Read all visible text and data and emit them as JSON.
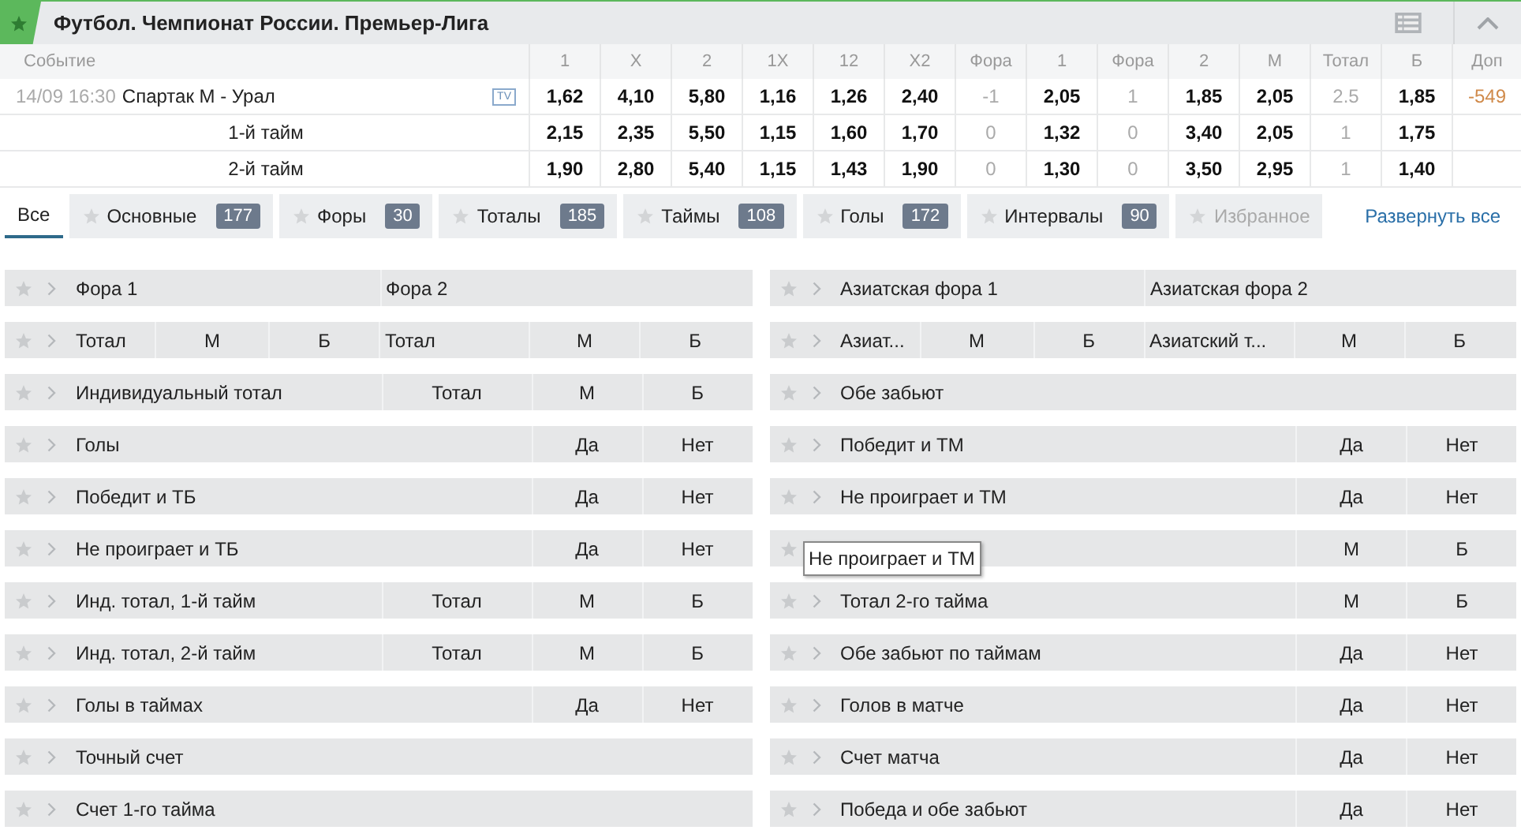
{
  "header": {
    "title": "Футбол. Чемпионат России. Премьер-Лига"
  },
  "table": {
    "event_heading": "Событие",
    "columns": [
      "1",
      "X",
      "2",
      "1X",
      "12",
      "X2",
      "Фора",
      "1",
      "Фора",
      "2",
      "М",
      "Тотал",
      "Б",
      "Доп"
    ],
    "rows": [
      {
        "kind": "match",
        "time": "14/09 16:30",
        "name": "Спартак М - Урал",
        "tv": "TV",
        "cells": [
          {
            "value": "1,62",
            "kind": "odd"
          },
          {
            "value": "4,10",
            "kind": "odd"
          },
          {
            "value": "5,80",
            "kind": "odd"
          },
          {
            "value": "1,16",
            "kind": "odd"
          },
          {
            "value": "1,26",
            "kind": "odd"
          },
          {
            "value": "2,40",
            "kind": "odd"
          },
          {
            "value": "-1",
            "kind": "param"
          },
          {
            "value": "2,05",
            "kind": "odd"
          },
          {
            "value": "1",
            "kind": "param"
          },
          {
            "value": "1,85",
            "kind": "odd"
          },
          {
            "value": "2,05",
            "kind": "odd"
          },
          {
            "value": "2.5",
            "kind": "param"
          },
          {
            "value": "1,85",
            "kind": "odd"
          },
          {
            "value": "-549",
            "kind": "extra"
          }
        ]
      },
      {
        "kind": "period",
        "name": "1-й тайм",
        "cells": [
          {
            "value": "2,15",
            "kind": "odd"
          },
          {
            "value": "2,35",
            "kind": "odd"
          },
          {
            "value": "5,50",
            "kind": "odd"
          },
          {
            "value": "1,15",
            "kind": "odd"
          },
          {
            "value": "1,60",
            "kind": "odd"
          },
          {
            "value": "1,70",
            "kind": "odd"
          },
          {
            "value": "0",
            "kind": "param"
          },
          {
            "value": "1,32",
            "kind": "odd"
          },
          {
            "value": "0",
            "kind": "param"
          },
          {
            "value": "3,40",
            "kind": "odd"
          },
          {
            "value": "2,05",
            "kind": "odd"
          },
          {
            "value": "1",
            "kind": "param"
          },
          {
            "value": "1,75",
            "kind": "odd"
          }
        ]
      },
      {
        "kind": "period",
        "name": "2-й тайм",
        "cells": [
          {
            "value": "1,90",
            "kind": "odd"
          },
          {
            "value": "2,80",
            "kind": "odd"
          },
          {
            "value": "5,40",
            "kind": "odd"
          },
          {
            "value": "1,15",
            "kind": "odd"
          },
          {
            "value": "1,43",
            "kind": "odd"
          },
          {
            "value": "1,90",
            "kind": "odd"
          },
          {
            "value": "0",
            "kind": "param"
          },
          {
            "value": "1,30",
            "kind": "odd"
          },
          {
            "value": "0",
            "kind": "param"
          },
          {
            "value": "3,50",
            "kind": "odd"
          },
          {
            "value": "2,95",
            "kind": "odd"
          },
          {
            "value": "1",
            "kind": "param"
          },
          {
            "value": "1,40",
            "kind": "odd"
          }
        ]
      }
    ]
  },
  "tabs": [
    {
      "kind": "all",
      "label": "Все",
      "selected": true,
      "disabled": false
    },
    {
      "kind": "category",
      "label": "Основные",
      "count": "177",
      "selected": false,
      "disabled": false
    },
    {
      "kind": "category",
      "label": "Форы",
      "count": "30",
      "selected": false,
      "disabled": false
    },
    {
      "kind": "category",
      "label": "Тоталы",
      "count": "185",
      "selected": false,
      "disabled": false
    },
    {
      "kind": "category",
      "label": "Таймы",
      "count": "108",
      "selected": false,
      "disabled": false
    },
    {
      "kind": "category",
      "label": "Голы",
      "count": "172",
      "selected": false,
      "disabled": false
    },
    {
      "kind": "category",
      "label": "Интервалы",
      "count": "90",
      "selected": false,
      "disabled": false
    },
    {
      "kind": "category",
      "label": "Избранное",
      "selected": false,
      "disabled": true
    }
  ],
  "expand_all": "Развернуть все",
  "markets": {
    "left": [
      {
        "kind": "pair",
        "cells": [
          "Фора 1",
          "Фора 2"
        ]
      },
      {
        "kind": "double",
        "cells": [
          "Тотал",
          "М",
          "Б",
          "Тотал",
          "М",
          "Б"
        ]
      },
      {
        "kind": "triple",
        "cells": [
          "Индивидуальный тотал",
          "Тотал",
          "М",
          "Б"
        ]
      },
      {
        "kind": "yesno",
        "cells": [
          "Голы",
          "Да",
          "Нет"
        ]
      },
      {
        "kind": "yesno",
        "cells": [
          "Победит и ТБ",
          "Да",
          "Нет"
        ]
      },
      {
        "kind": "yesno",
        "cells": [
          "Не проиграет и ТБ",
          "Да",
          "Нет"
        ]
      },
      {
        "kind": "triple",
        "cells": [
          "Инд. тотал, 1-й тайм",
          "Тотал",
          "М",
          "Б"
        ]
      },
      {
        "kind": "triple",
        "cells": [
          "Инд. тотал, 2-й тайм",
          "Тотал",
          "М",
          "Б"
        ]
      },
      {
        "kind": "yesno",
        "cells": [
          "Голы в таймах",
          "Да",
          "Нет"
        ]
      },
      {
        "kind": "single",
        "cells": [
          "Точный счет"
        ]
      },
      {
        "kind": "single",
        "cells": [
          "Счет 1-го тайма"
        ]
      }
    ],
    "right": [
      {
        "kind": "pair",
        "cells": [
          "Азиатская фора 1",
          "Азиатская фора 2"
        ]
      },
      {
        "kind": "double",
        "cells": [
          "Азиат...",
          "М",
          "Б",
          "Азиатский т...",
          "М",
          "Б"
        ]
      },
      {
        "kind": "single",
        "cells": [
          "Обе забьют"
        ]
      },
      {
        "kind": "yesno",
        "cells": [
          "Победит и ТМ",
          "Да",
          "Нет"
        ]
      },
      {
        "kind": "yesno",
        "cells": [
          "Не проиграет и ТМ",
          "Да",
          "Нет"
        ]
      },
      {
        "kind": "covered",
        "cells": [
          "М",
          "Б"
        ],
        "tooltip": "Не проиграет и ТМ"
      },
      {
        "kind": "yesno",
        "cells": [
          "Тотал 2-го тайма",
          "М",
          "Б"
        ]
      },
      {
        "kind": "yesno",
        "cells": [
          "Обе забьют по таймам",
          "Да",
          "Нет"
        ]
      },
      {
        "kind": "yesno",
        "cells": [
          "Голов в матче",
          "Да",
          "Нет"
        ]
      },
      {
        "kind": "yesno",
        "cells": [
          "Счет матча",
          "Да",
          "Нет"
        ]
      },
      {
        "kind": "yesno",
        "cells": [
          "Победа и обе забьют",
          "Да",
          "Нет"
        ]
      }
    ]
  }
}
